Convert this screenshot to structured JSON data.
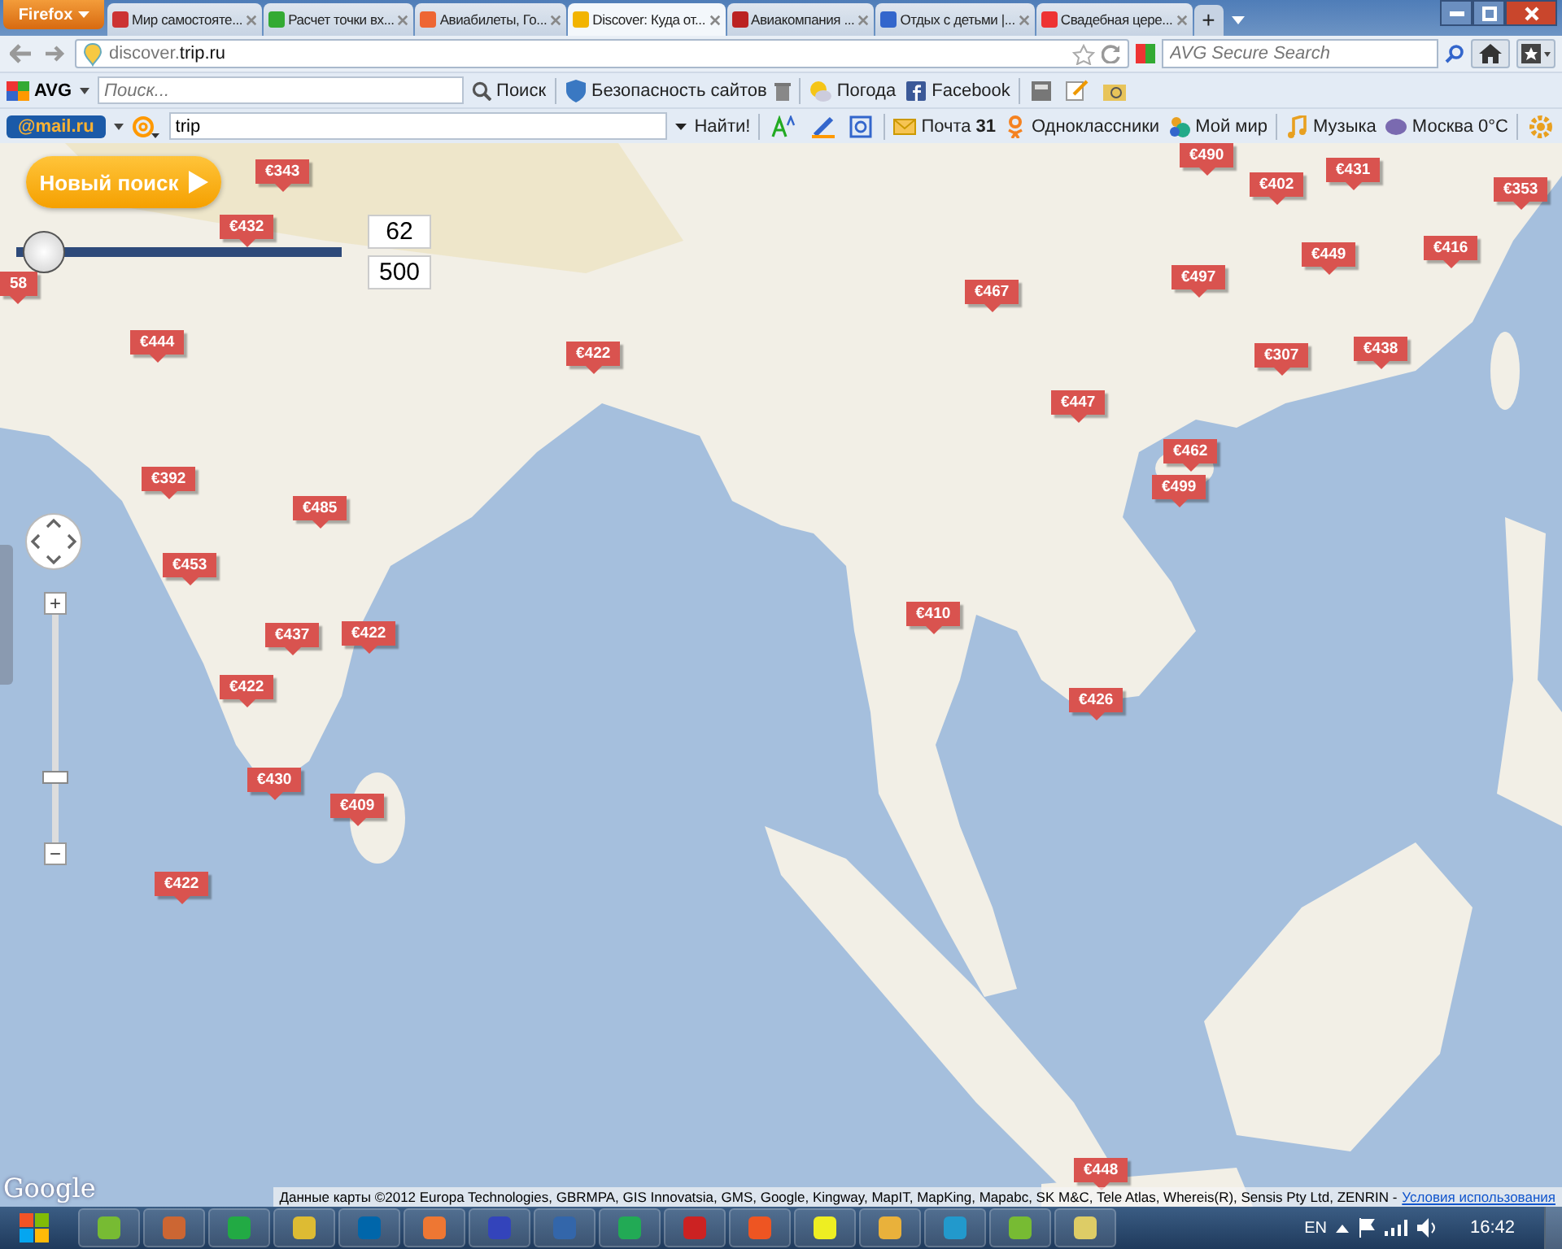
{
  "browser": {
    "menu_button": "Firefox",
    "tabs": [
      {
        "title": "Мир самостояте...",
        "selected": false
      },
      {
        "title": "Расчет точки вх...",
        "selected": false
      },
      {
        "title": "Авиабилеты, Го...",
        "selected": false
      },
      {
        "title": "Discover: Куда от...",
        "selected": true
      },
      {
        "title": "Авиакомпания ...",
        "selected": false
      },
      {
        "title": "Отдых с детьми |...",
        "selected": false
      },
      {
        "title": "Свадебная цере...",
        "selected": false
      }
    ],
    "new_tab": "+",
    "address": "discover.**trip.ru**",
    "search": {
      "placeholder": "AVG Secure Search"
    }
  },
  "avg_toolbar": {
    "logo": "AVG",
    "search_placeholder": "Поиск...",
    "search_button": "Поиск",
    "items": [
      "Безопасность сайтов",
      "Погода",
      "Facebook"
    ]
  },
  "mail_toolbar": {
    "logo": "@mail.ru",
    "query": "trip",
    "find_button": "Найти!",
    "items": [
      {
        "label": "Почта **31**"
      },
      {
        "label": "Одноклассники"
      },
      {
        "label": "Мой мир"
      },
      {
        "label": "Музыка"
      },
      {
        "label": "Москва 0°C"
      }
    ]
  },
  "map": {
    "new_search": "Новый поиск",
    "price_range": {
      "level": 0.02,
      "min": "62",
      "max": "500"
    },
    "zoom": {
      "level": 0.28,
      "zoom_in": "+",
      "zoom_out": "−"
    },
    "markers": [
      {
        "price": "€343"
      },
      {
        "price": "€432"
      },
      {
        "price": "58"
      },
      {
        "price": "€444"
      },
      {
        "price": "€422"
      },
      {
        "price": "€392"
      },
      {
        "price": "€485"
      },
      {
        "price": "€453"
      },
      {
        "price": "€437"
      },
      {
        "price": "€422"
      },
      {
        "price": "€422"
      },
      {
        "price": "€430"
      },
      {
        "price": "€409"
      },
      {
        "price": "€422"
      },
      {
        "price": "€467"
      },
      {
        "price": "€490"
      },
      {
        "price": "€402"
      },
      {
        "price": "€431"
      },
      {
        "price": "€353"
      },
      {
        "price": "€449"
      },
      {
        "price": "€416"
      },
      {
        "price": "€497"
      },
      {
        "price": "€307"
      },
      {
        "price": "€438"
      },
      {
        "price": "€447"
      },
      {
        "price": "€462"
      },
      {
        "price": "€499"
      },
      {
        "price": "€410"
      },
      {
        "price": "€426"
      },
      {
        "price": "€448"
      }
    ],
    "google_logo": "Google",
    "attribution": "Данные карты ©2012 Europa Technologies, GBRMPA, GIS Innovatsia, GMS, Google, Kingway, MapIT, MapKing, Mapabc, SK M&C, Tele Atlas, Whereis(R), Sensis Pty Ltd, ZENRIN -",
    "terms_link": "Условия использования"
  },
  "taskbar": {
    "language": "EN",
    "clock": "16:42"
  }
}
